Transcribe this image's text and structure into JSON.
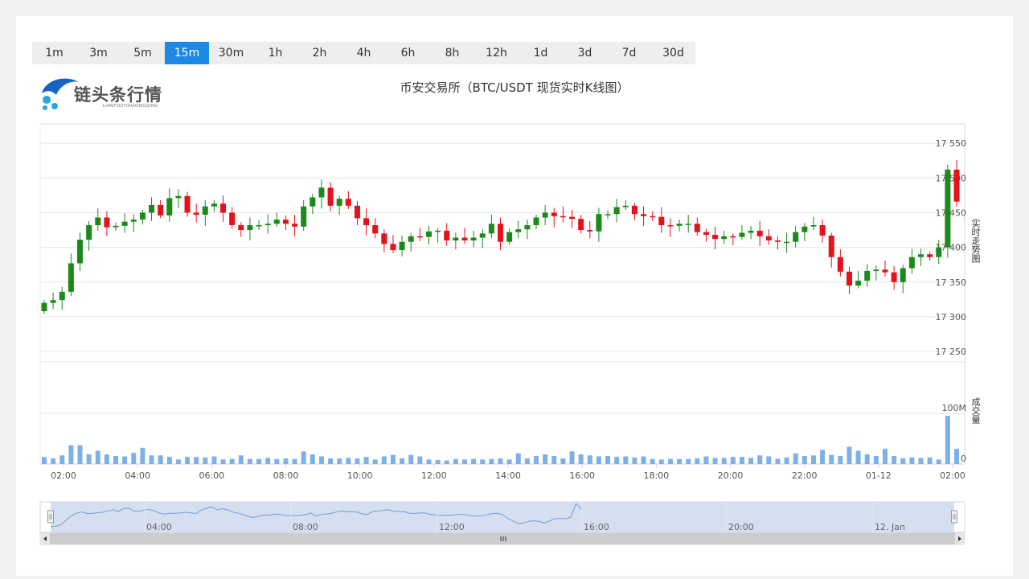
{
  "tabs": [
    {
      "label": "1m"
    },
    {
      "label": "3m"
    },
    {
      "label": "5m"
    },
    {
      "label": "15m",
      "active": true
    },
    {
      "label": "30m"
    },
    {
      "label": "1h"
    },
    {
      "label": "2h"
    },
    {
      "label": "4h"
    },
    {
      "label": "6h"
    },
    {
      "label": "8h"
    },
    {
      "label": "12h"
    },
    {
      "label": "1d"
    },
    {
      "label": "3d"
    },
    {
      "label": "7d"
    },
    {
      "label": "30d"
    }
  ],
  "logo": {
    "text": "链头条行情",
    "sub": "LIANTOUTIAOXINGQING",
    "icon": "wave-logo-icon"
  },
  "title": "币安交易所（BTC/USDT 现货实时K线图）",
  "colors": {
    "up": "#1b8a1b",
    "down": "#e5111b",
    "volume": "#7eb0e8",
    "accent": "#1e88e5",
    "navigator_fill": "#d2dcee",
    "navigator_line": "#6f9fd8"
  },
  "chart_data": {
    "type": "candlestick",
    "y_label": "实时走势图",
    "volume_label": "成交量",
    "y_ticks": [
      "17 550",
      "17 500",
      "17 450",
      "17 400",
      "17 350",
      "17 300",
      "17 250"
    ],
    "y_tick_values": [
      17550,
      17500,
      17450,
      17400,
      17350,
      17300,
      17250
    ],
    "ylim": [
      17235,
      17578
    ],
    "volume_ticks": [
      "100M",
      "0"
    ],
    "x_ticks": [
      "02:00",
      "04:00",
      "06:00",
      "08:00",
      "10:00",
      "12:00",
      "14:00",
      "16:00",
      "18:00",
      "20:00",
      "22:00",
      "01-12",
      "02:00"
    ],
    "navigator_ticks": [
      "04:00",
      "08:00",
      "12:00",
      "16:00",
      "20:00",
      "12. Jan"
    ],
    "closes": [
      17320,
      17324,
      17336,
      17377,
      17411,
      17432,
      17443,
      17429,
      17431,
      17437,
      17440,
      17450,
      17461,
      17446,
      17471,
      17474,
      17450,
      17447,
      17459,
      17463,
      17450,
      17432,
      17425,
      17432,
      17432,
      17434,
      17440,
      17434,
      17430,
      17459,
      17472,
      17486,
      17460,
      17470,
      17460,
      17442,
      17432,
      17420,
      17405,
      17396,
      17408,
      17416,
      17415,
      17423,
      17424,
      17410,
      17414,
      17410,
      17414,
      17420,
      17434,
      17408,
      17422,
      17426,
      17432,
      17443,
      17450,
      17445,
      17444,
      17441,
      17425,
      17423,
      17448,
      17448,
      17458,
      17460,
      17448,
      17445,
      17444,
      17432,
      17431,
      17434,
      17434,
      17422,
      17418,
      17412,
      17416,
      17415,
      17421,
      17424,
      17416,
      17410,
      17408,
      17408,
      17422,
      17430,
      17432,
      17417,
      17386,
      17365,
      17345,
      17352,
      17366,
      17368,
      17364,
      17350,
      17370,
      17386,
      17390,
      17386,
      17400,
      17512,
      17466
    ],
    "volumes": [
      14,
      11,
      17,
      37,
      37,
      19,
      26,
      19,
      16,
      15,
      22,
      32,
      17,
      17,
      14,
      9,
      14,
      14,
      13,
      15,
      9,
      10,
      17,
      10,
      10,
      12,
      10,
      11,
      10,
      25,
      19,
      15,
      11,
      11,
      12,
      11,
      14,
      9,
      15,
      18,
      11,
      18,
      15,
      9,
      8,
      7,
      10,
      9,
      10,
      9,
      10,
      11,
      9,
      21,
      11,
      16,
      19,
      16,
      11,
      25,
      19,
      17,
      15,
      16,
      14,
      15,
      13,
      15,
      10,
      9,
      10,
      10,
      10,
      11,
      15,
      12,
      12,
      14,
      14,
      12,
      17,
      15,
      10,
      13,
      21,
      16,
      17,
      28,
      18,
      16,
      34,
      26,
      19,
      16,
      30,
      16,
      11,
      13,
      12,
      13,
      9,
      95,
      30
    ],
    "vmax": 100
  }
}
